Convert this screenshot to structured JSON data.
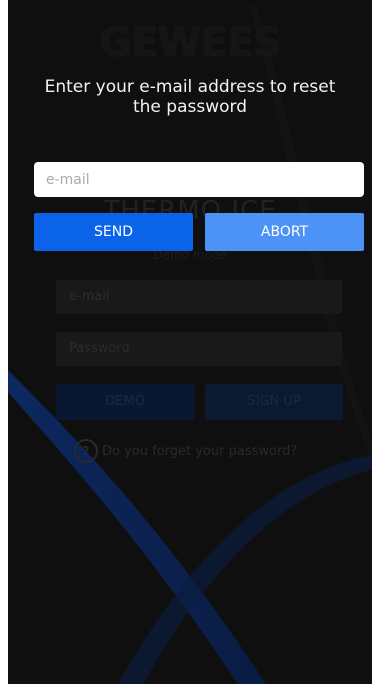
{
  "colors": {
    "screen_bg": "#0f0f10",
    "send_button": "#0a63e8",
    "abort_button": "#4d92f6",
    "title_text": "#f2f2f2"
  },
  "background_form": {
    "logo": "GEWEES",
    "brand": "THERMO ICE",
    "subtitle": "Demo mode",
    "email_placeholder": "e-mail",
    "password_placeholder": "Password",
    "demo_label": "DEMO",
    "signup_label": "SIGN UP",
    "forgot_icon": "question-circle-icon",
    "forgot_text": "Do you forget your password?"
  },
  "reset_dialog": {
    "title": "Enter your e-mail address to reset the password",
    "email_placeholder": "e-mail",
    "email_value": "",
    "send_label": "SEND",
    "abort_label": "ABORT"
  }
}
